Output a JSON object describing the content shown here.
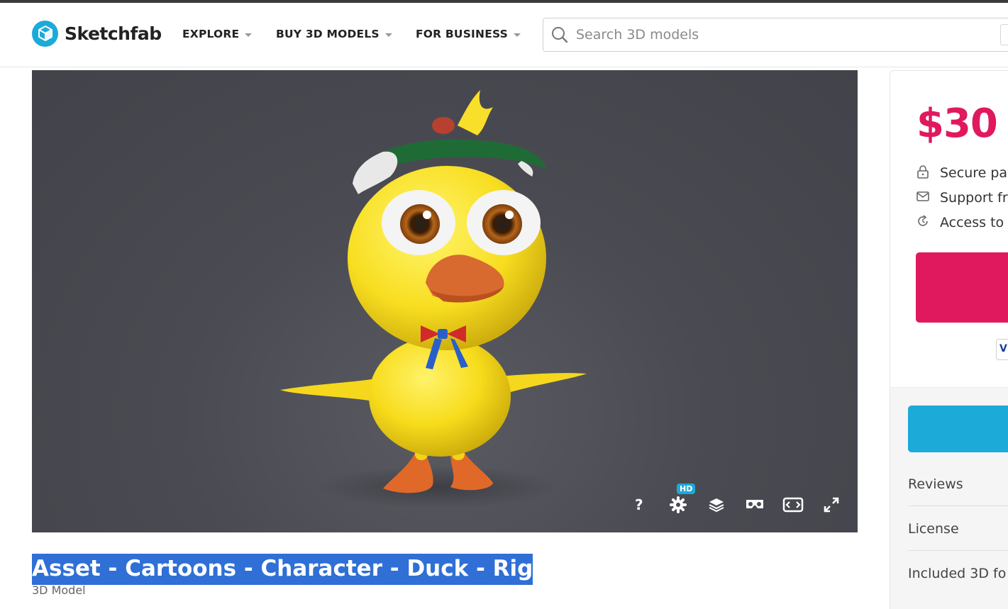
{
  "header": {
    "brand": "Sketchfab",
    "nav": [
      {
        "label": "EXPLORE"
      },
      {
        "label": "BUY 3D MODELS"
      },
      {
        "label": "FOR BUSINESS"
      }
    ],
    "search_placeholder": "Search 3D models"
  },
  "viewer": {
    "controls": [
      {
        "icon": "help-icon"
      },
      {
        "icon": "settings-icon",
        "badge": "HD"
      },
      {
        "icon": "layers-icon"
      },
      {
        "icon": "vr-icon"
      },
      {
        "icon": "theater-mode-icon"
      },
      {
        "icon": "fullscreen-icon"
      }
    ],
    "help_glyph": "?"
  },
  "model": {
    "title": "Asset - Cartoons - Character - Duck - Rig",
    "subtitle": "3D Model"
  },
  "sidebar": {
    "price": "$30",
    "features": [
      {
        "icon": "lock-icon",
        "text": "Secure pay"
      },
      {
        "icon": "mail-icon",
        "text": "Support fr"
      },
      {
        "icon": "update-icon",
        "text": "Access to f"
      }
    ],
    "card_badge": "V",
    "links": [
      {
        "label": "Reviews"
      },
      {
        "label": "License"
      },
      {
        "label": "Included 3D fo"
      }
    ]
  },
  "colors": {
    "brand_blue": "#1caad9",
    "price_pink": "#e0195f",
    "selection_blue": "#2f6fd6"
  }
}
